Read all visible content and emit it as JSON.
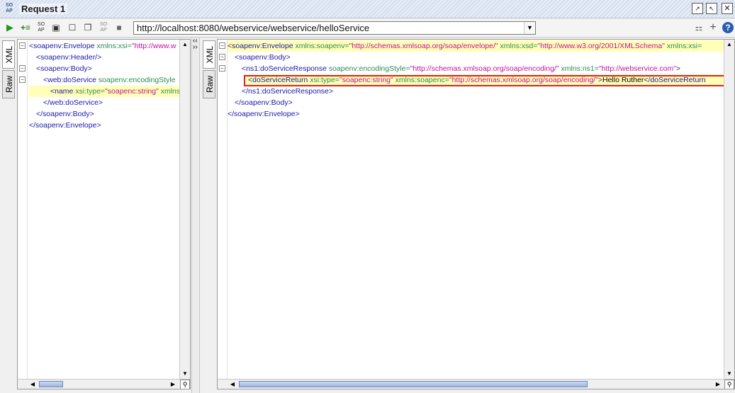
{
  "window": {
    "title": "Request 1",
    "icon_label": "SOAP"
  },
  "toolbar": {
    "url": "http://localhost:8080/webservice/webservice/helloService",
    "buttons": [
      "run-icon",
      "add-assertion-icon",
      "wsa-icon",
      "fullscreen-icon",
      "square-icon",
      "copy-icon",
      "soap-icon",
      "stop-icon"
    ]
  },
  "tabs": {
    "xml": "XML",
    "raw": "Raw"
  },
  "request": {
    "lines": [
      {
        "indent": 0,
        "open": "<soapenv:Envelope",
        "attr": " xmlns:xsi=",
        "val": "\"http://www.w",
        "rest": ""
      },
      {
        "indent": 1,
        "open": "<soapenv:Header/>",
        "attr": "",
        "val": "",
        "rest": ""
      },
      {
        "indent": 1,
        "open": "<soapenv:Body>",
        "attr": "",
        "val": "",
        "rest": ""
      },
      {
        "indent": 2,
        "open": "<web:doService",
        "attr": " soapenv:encodingStyle",
        "val": "",
        "rest": ""
      },
      {
        "indent": 3,
        "open": "<name",
        "attr": " xsi:type=",
        "val": "\"soapenc:string\"",
        "rest": " xmlns"
      },
      {
        "indent": 2,
        "open": "</web:doService>",
        "attr": "",
        "val": "",
        "rest": ""
      },
      {
        "indent": 1,
        "open": "</soapenv:Body>",
        "attr": "",
        "val": "",
        "rest": ""
      },
      {
        "indent": 0,
        "open": "</soapenv:Envelope>",
        "attr": "",
        "val": "",
        "rest": ""
      }
    ]
  },
  "response": {
    "line0_tag": "soapenv:Envelope",
    "line0_a1": " xmlns:soapenv=",
    "line0_v1": "\"http://schemas.xmlsoap.org/soap/envelope/\"",
    "line0_a2": " xmlns:xsd=",
    "line0_v2": "\"http://www.w3.org/2001/XMLSchema\"",
    "line0_a3": " xmlns:xsi=",
    "line1": "<soapenv:Body>",
    "line2_tag": "<ns1:doServiceResponse",
    "line2_a1": " soapenv:encodingStyle=",
    "line2_v1": "\"http://schemas.xmlsoap.org/soap/encoding/\"",
    "line2_a2": " xmlns:ns1=",
    "line2_v2": "\"http://webservice.com\"",
    "line2_end": ">",
    "line3_tag": "<doServiceReturn",
    "line3_a1": " xsi:type=",
    "line3_v1": "\"soapenc:string\"",
    "line3_a2": " xmlns:soapenc=",
    "line3_v2": "\"http://schemas.xmlsoap.org/soap/encoding/\"",
    "line3_gt": ">",
    "line3_text": "Hello Ruther",
    "line3_close": "</doServiceReturn",
    "line4": "</ns1:doServiceResponse>",
    "line5": "</soapenv:Body>",
    "line6": "</soapenv:Envelope>"
  }
}
